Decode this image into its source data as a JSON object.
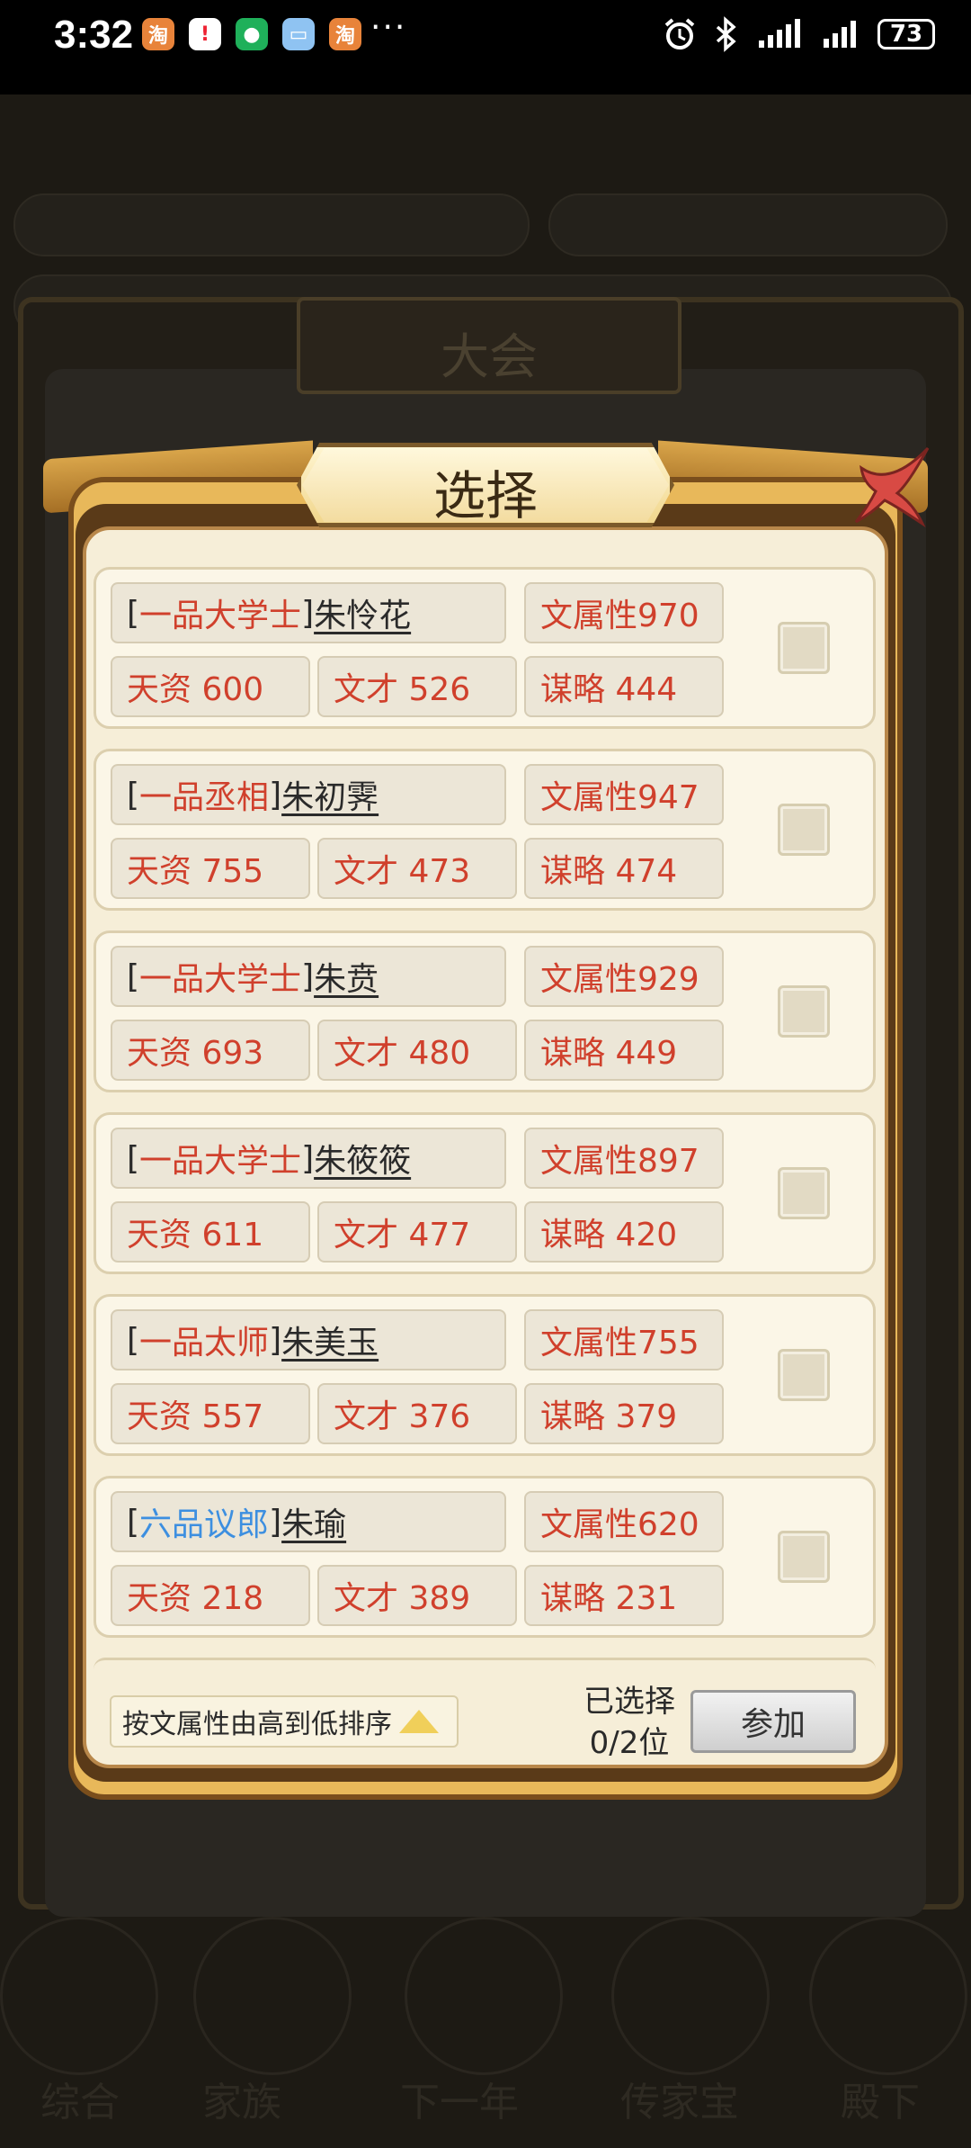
{
  "status_bar": {
    "time": "3:32",
    "more": "···",
    "battery": "73",
    "app_icons": [
      "taobao-icon",
      "xiaohongshu-icon",
      "wechat-icon",
      "message-icon",
      "taobao-icon"
    ]
  },
  "background": {
    "title": "大会",
    "tabs": [
      "综合",
      "家族",
      "下一年",
      "传家宝",
      "殿下"
    ]
  },
  "modal": {
    "title": "选择",
    "candidates": [
      {
        "rank": "一品大学士",
        "rank_color": "red",
        "name": "朱怜花",
        "attr": "文属性970",
        "tianzi": "天资 600",
        "wencai": "文才 526",
        "moulue": "谋略 444"
      },
      {
        "rank": "一品丞相",
        "rank_color": "red",
        "name": "朱初霁",
        "attr": "文属性947",
        "tianzi": "天资 755",
        "wencai": "文才 473",
        "moulue": "谋略 474"
      },
      {
        "rank": "一品大学士",
        "rank_color": "red",
        "name": "朱贲",
        "attr": "文属性929",
        "tianzi": "天资 693",
        "wencai": "文才 480",
        "moulue": "谋略 449"
      },
      {
        "rank": "一品大学士",
        "rank_color": "red",
        "name": "朱筱筱",
        "attr": "文属性897",
        "tianzi": "天资 611",
        "wencai": "文才 477",
        "moulue": "谋略 420"
      },
      {
        "rank": "一品太师",
        "rank_color": "red",
        "name": "朱美玉",
        "attr": "文属性755",
        "tianzi": "天资 557",
        "wencai": "文才 376",
        "moulue": "谋略 379"
      },
      {
        "rank": "六品议郎",
        "rank_color": "blue",
        "name": "朱瑜",
        "attr": "文属性620",
        "tianzi": "天资 218",
        "wencai": "文才 389",
        "moulue": "谋略 231"
      }
    ],
    "sort_label": "按文属性由高到低排序",
    "selected_label": "已选择",
    "selected_count": "0/2位",
    "join_label": "参加"
  }
}
